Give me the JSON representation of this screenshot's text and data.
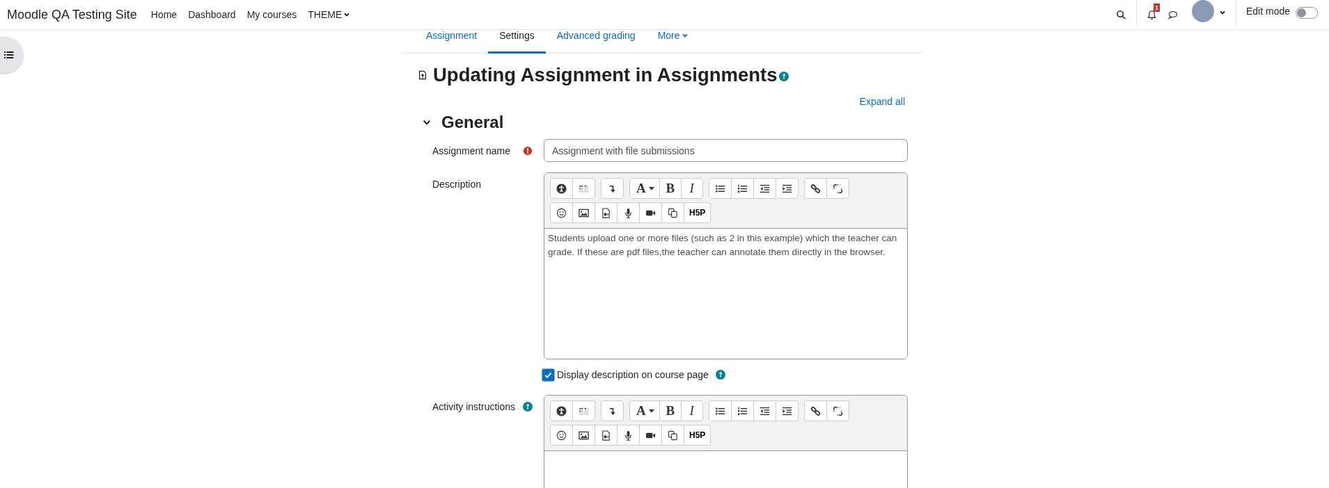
{
  "navbar": {
    "brand": "Moodle QA Testing Site",
    "links": [
      {
        "label": "Home",
        "dropdown": false
      },
      {
        "label": "Dashboard",
        "dropdown": false
      },
      {
        "label": "My courses",
        "dropdown": false
      },
      {
        "label": "THEME",
        "dropdown": true
      }
    ],
    "notification_count": "1",
    "edit_mode": {
      "label": "Edit mode",
      "on": false
    }
  },
  "tabs": [
    {
      "label": "Assignment",
      "selected": false,
      "dropdown": false
    },
    {
      "label": "Settings",
      "selected": true,
      "dropdown": false
    },
    {
      "label": "Advanced grading",
      "selected": false,
      "dropdown": false
    },
    {
      "label": "More",
      "selected": false,
      "dropdown": true
    }
  ],
  "heading": "Updating Assignment in Assignments",
  "expand_all": "Expand all",
  "section": {
    "title": "General",
    "expanded": true
  },
  "fields": [
    {
      "kind": "text",
      "label": "Assignment name",
      "required": true,
      "help": false,
      "value": "Assignment with file submissions"
    },
    {
      "kind": "editor",
      "label": "Description",
      "required": false,
      "help": false,
      "content": "Students upload one or more files (such as 2 in this example) which the teacher can grade. If these are pdf files,the teacher can annotate them directly in the browser.",
      "toolbar": [
        [
          [
            {
              "kind": "accessibility"
            },
            {
              "kind": "screenreader"
            }
          ],
          [
            {
              "kind": "paragraph"
            }
          ],
          [
            {
              "kind": "font",
              "label": "A"
            },
            {
              "kind": "bold",
              "label": "B"
            },
            {
              "kind": "italic",
              "label": "I"
            }
          ],
          [
            {
              "kind": "bullet-list"
            },
            {
              "kind": "numbered-list"
            },
            {
              "kind": "outdent"
            },
            {
              "kind": "indent"
            }
          ],
          [
            {
              "kind": "link"
            },
            {
              "kind": "unlink"
            }
          ]
        ],
        [
          [
            {
              "kind": "emoji"
            },
            {
              "kind": "image"
            },
            {
              "kind": "media"
            },
            {
              "kind": "microphone"
            },
            {
              "kind": "video"
            },
            {
              "kind": "copy"
            },
            {
              "kind": "h5p",
              "label": "H5P"
            }
          ]
        ]
      ]
    },
    {
      "kind": "checkbox",
      "label": "Display description on course page",
      "checked": true,
      "help": true
    },
    {
      "kind": "editor",
      "label": "Activity instructions",
      "required": false,
      "help": true,
      "toolbar": [
        [
          [
            {
              "kind": "accessibility"
            },
            {
              "kind": "screenreader"
            }
          ],
          [
            {
              "kind": "paragraph"
            }
          ],
          [
            {
              "kind": "font",
              "label": "A"
            },
            {
              "kind": "bold",
              "label": "B"
            },
            {
              "kind": "italic",
              "label": "I"
            }
          ],
          [
            {
              "kind": "bullet-list"
            },
            {
              "kind": "numbered-list"
            },
            {
              "kind": "outdent"
            },
            {
              "kind": "indent"
            }
          ],
          [
            {
              "kind": "link"
            },
            {
              "kind": "unlink"
            }
          ]
        ],
        [
          [
            {
              "kind": "emoji"
            },
            {
              "kind": "image"
            },
            {
              "kind": "media"
            },
            {
              "kind": "microphone"
            },
            {
              "kind": "video"
            },
            {
              "kind": "copy"
            },
            {
              "kind": "h5p",
              "label": "H5P"
            }
          ]
        ]
      ]
    }
  ]
}
